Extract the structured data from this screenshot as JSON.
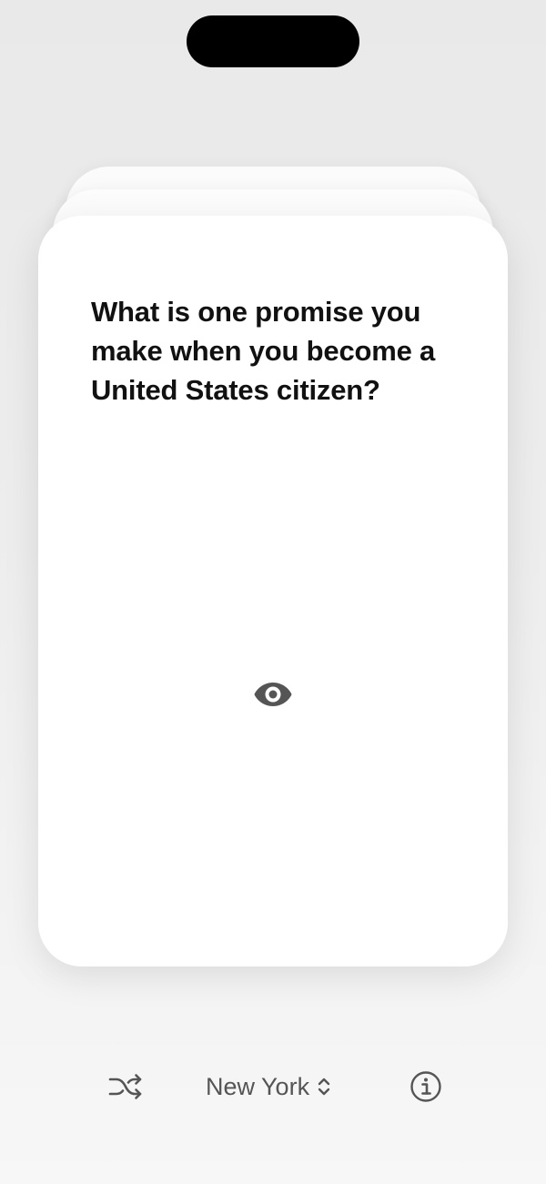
{
  "card": {
    "question": "What is one promise you make when you become a United States citizen?",
    "reveal_icon": "eye-icon"
  },
  "toolbar": {
    "shuffle_icon": "shuffle-icon",
    "state_label": "New York",
    "state_picker_icon": "chevron-up-down-icon",
    "info_icon": "info-circle-icon"
  },
  "colors": {
    "background": "#ececec",
    "card": "#ffffff",
    "text": "#111111",
    "icon": "#555555"
  }
}
